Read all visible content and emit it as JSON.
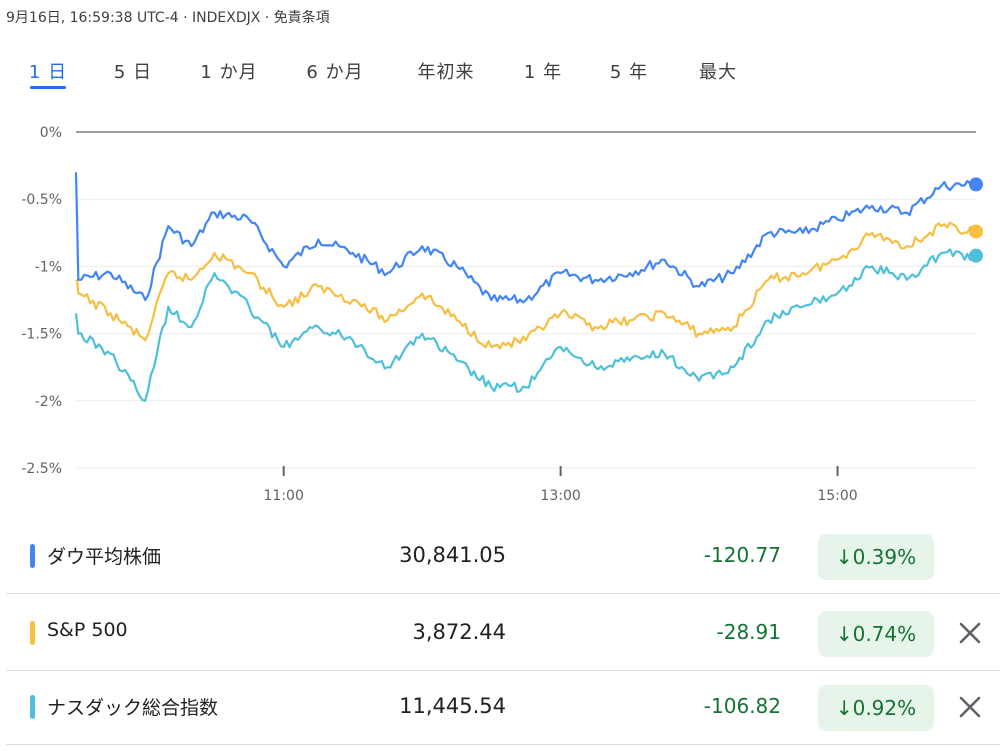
{
  "header": {
    "meta": "9月16日, 16:59:38 UTC-4 · INDEXDJX · 免責条項"
  },
  "tabs": [
    {
      "label": "1 日",
      "active": true
    },
    {
      "label": "5 日",
      "active": false
    },
    {
      "label": "1 か月",
      "active": false
    },
    {
      "label": "6 か月",
      "active": false
    },
    {
      "label": "年初来",
      "active": false
    },
    {
      "label": "1 年",
      "active": false
    },
    {
      "label": "5 年",
      "active": false
    },
    {
      "label": "最大",
      "active": false
    }
  ],
  "chart_data": {
    "type": "line",
    "ylim": [
      -2.5,
      0
    ],
    "yticks": [
      "0%",
      "-0.5%",
      "-1%",
      "-1.5%",
      "-2%",
      "-2.5%"
    ],
    "ytick_values": [
      0,
      -0.5,
      -1,
      -1.5,
      -2,
      -2.5
    ],
    "xticks": [
      "11:00",
      "13:00",
      "15:00"
    ],
    "xtick_values": [
      "11:00",
      "13:00",
      "15:00"
    ],
    "x_range": [
      "09:30",
      "16:00"
    ],
    "grid": true,
    "series": [
      {
        "name": "ダウ平均株価",
        "color": "#4285f4",
        "x": [
          "09:30",
          "09:31",
          "09:45",
          "10:00",
          "10:10",
          "10:20",
          "10:30",
          "10:45",
          "11:00",
          "11:15",
          "11:30",
          "11:45",
          "12:00",
          "12:15",
          "12:30",
          "12:45",
          "13:00",
          "13:15",
          "13:30",
          "13:45",
          "14:00",
          "14:15",
          "14:30",
          "14:45",
          "15:00",
          "15:15",
          "15:30",
          "15:45",
          "16:00"
        ],
        "values": [
          -0.3,
          -1.1,
          -1.05,
          -1.25,
          -0.7,
          -0.85,
          -0.6,
          -0.65,
          -1.0,
          -0.8,
          -0.9,
          -1.05,
          -0.85,
          -1.0,
          -1.25,
          -1.25,
          -1.05,
          -1.1,
          -1.05,
          -0.95,
          -1.15,
          -1.05,
          -0.75,
          -0.75,
          -0.65,
          -0.55,
          -0.6,
          -0.4,
          -0.39
        ]
      },
      {
        "name": "S&P 500",
        "color": "#f6bf42",
        "x": [
          "09:30",
          "09:31",
          "09:45",
          "10:00",
          "10:10",
          "10:20",
          "10:30",
          "10:45",
          "11:00",
          "11:15",
          "11:30",
          "11:45",
          "12:00",
          "12:15",
          "12:30",
          "12:45",
          "13:00",
          "13:15",
          "13:30",
          "13:45",
          "14:00",
          "14:15",
          "14:30",
          "14:45",
          "15:00",
          "15:15",
          "15:30",
          "15:45",
          "16:00"
        ],
        "values": [
          -1.1,
          -1.2,
          -1.35,
          -1.55,
          -1.05,
          -1.1,
          -0.9,
          -1.05,
          -1.3,
          -1.15,
          -1.25,
          -1.4,
          -1.2,
          -1.4,
          -1.6,
          -1.55,
          -1.35,
          -1.45,
          -1.4,
          -1.35,
          -1.5,
          -1.45,
          -1.1,
          -1.05,
          -0.95,
          -0.75,
          -0.85,
          -0.7,
          -0.74
        ]
      },
      {
        "name": "ナスダック総合指数",
        "color": "#4ec0d9",
        "x": [
          "09:30",
          "09:31",
          "09:45",
          "10:00",
          "10:10",
          "10:20",
          "10:30",
          "10:45",
          "11:00",
          "11:15",
          "11:30",
          "11:45",
          "12:00",
          "12:15",
          "12:30",
          "12:45",
          "13:00",
          "13:15",
          "13:30",
          "13:45",
          "14:00",
          "14:15",
          "14:30",
          "14:45",
          "15:00",
          "15:15",
          "15:30",
          "15:45",
          "16:00"
        ],
        "values": [
          -1.35,
          -1.5,
          -1.65,
          -2.0,
          -1.3,
          -1.45,
          -1.05,
          -1.3,
          -1.6,
          -1.45,
          -1.55,
          -1.75,
          -1.5,
          -1.7,
          -1.9,
          -1.9,
          -1.6,
          -1.75,
          -1.7,
          -1.65,
          -1.85,
          -1.75,
          -1.4,
          -1.3,
          -1.2,
          -1.0,
          -1.1,
          -0.9,
          -0.92
        ]
      }
    ]
  },
  "rows": [
    {
      "name": "ダウ平均株価",
      "color": "#4285f4",
      "price": "30,841.05",
      "change": "-120.77",
      "pct": "↓0.39%",
      "closable": false
    },
    {
      "name": "S&P 500",
      "color": "#f6bf42",
      "price": "3,872.44",
      "change": "-28.91",
      "pct": "↓0.74%",
      "closable": true
    },
    {
      "name": "ナスダック総合指数",
      "color": "#4ec0d9",
      "price": "11,445.54",
      "change": "-106.82",
      "pct": "↓0.92%",
      "closable": true
    }
  ],
  "icons": {
    "close": "close-icon"
  }
}
